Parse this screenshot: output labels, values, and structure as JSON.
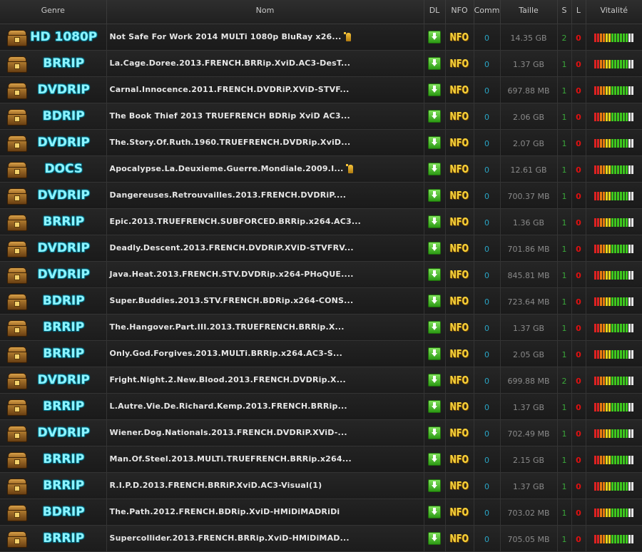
{
  "headers": {
    "genre": "Genre",
    "name": "Nom",
    "dl": "DL",
    "nfo": "NFO",
    "comm": "Comm",
    "size": "Taille",
    "s": "S",
    "l": "L",
    "vit": "Vitalité"
  },
  "rows": [
    {
      "genre": "HD 1080P",
      "name": "Not Safe For Work 2014 MULTi 1080p BluRay x26...",
      "fav": true,
      "nfo": "NFO",
      "comm": "0",
      "size": "14.35 GB",
      "s": "2",
      "l": "0"
    },
    {
      "genre": "BRRIP",
      "name": "La.Cage.Doree.2013.FRENCH.BRRip.XviD.AC3-DesT...",
      "fav": false,
      "nfo": "NFO",
      "comm": "0",
      "size": "1.37 GB",
      "s": "1",
      "l": "0"
    },
    {
      "genre": "DVDRIP",
      "name": "Carnal.Innocence.2011.FRENCH.DVDRiP.XViD-STVF...",
      "fav": false,
      "nfo": "NFO",
      "comm": "0",
      "size": "697.88 MB",
      "s": "1",
      "l": "0"
    },
    {
      "genre": "BDRIP",
      "name": "The Book Thief 2013 TRUEFRENCH BDRip XviD AC3...",
      "fav": false,
      "nfo": "NFO",
      "comm": "0",
      "size": "2.06 GB",
      "s": "1",
      "l": "0"
    },
    {
      "genre": "DVDRIP",
      "name": "The.Story.Of.Ruth.1960.TRUEFRENCH.DVDRip.XviD...",
      "fav": false,
      "nfo": "NFO",
      "comm": "0",
      "size": "2.07 GB",
      "s": "1",
      "l": "0"
    },
    {
      "genre": "DOCS",
      "name": "Apocalypse.La.Deuxieme.Guerre.Mondiale.2009.I...",
      "fav": true,
      "nfo": "NFO",
      "comm": "0",
      "size": "12.61 GB",
      "s": "1",
      "l": "0"
    },
    {
      "genre": "DVDRIP",
      "name": "Dangereuses.Retrouvailles.2013.FRENCH.DVDRiP....",
      "fav": false,
      "nfo": "NFO",
      "comm": "0",
      "size": "700.37 MB",
      "s": "1",
      "l": "0"
    },
    {
      "genre": "BRRIP",
      "name": "Epic.2013.TRUEFRENCH.SUBFORCED.BRRip.x264.AC3...",
      "fav": false,
      "nfo": "NFO",
      "comm": "0",
      "size": "1.36 GB",
      "s": "1",
      "l": "0"
    },
    {
      "genre": "DVDRIP",
      "name": "Deadly.Descent.2013.FRENCH.DVDRiP.XViD-STVFRV...",
      "fav": false,
      "nfo": "NFO",
      "comm": "0",
      "size": "701.86 MB",
      "s": "1",
      "l": "0"
    },
    {
      "genre": "DVDRIP",
      "name": "Java.Heat.2013.FRENCH.STV.DVDRip.x264-PHoQUE....",
      "fav": false,
      "nfo": "NFO",
      "comm": "0",
      "size": "845.81 MB",
      "s": "1",
      "l": "0"
    },
    {
      "genre": "BDRIP",
      "name": "Super.Buddies.2013.STV.FRENCH.BDRip.x264-CONS...",
      "fav": false,
      "nfo": "NFO",
      "comm": "0",
      "size": "723.64 MB",
      "s": "1",
      "l": "0"
    },
    {
      "genre": "BRRIP",
      "name": "The.Hangover.Part.III.2013.TRUEFRENCH.BRRip.X...",
      "fav": false,
      "nfo": "NFO",
      "comm": "0",
      "size": "1.37 GB",
      "s": "1",
      "l": "0"
    },
    {
      "genre": "BRRIP",
      "name": "Only.God.Forgives.2013.MULTi.BRRip.x264.AC3-S...",
      "fav": false,
      "nfo": "NFO",
      "comm": "0",
      "size": "2.05 GB",
      "s": "1",
      "l": "0"
    },
    {
      "genre": "DVDRIP",
      "name": "Fright.Night.2.New.Blood.2013.FRENCH.DVDRip.X...",
      "fav": false,
      "nfo": "NFO",
      "comm": "0",
      "size": "699.88 MB",
      "s": "2",
      "l": "0"
    },
    {
      "genre": "BRRIP",
      "name": "L.Autre.Vie.De.Richard.Kemp.2013.FRENCH.BRRip...",
      "fav": false,
      "nfo": "NFO",
      "comm": "0",
      "size": "1.37 GB",
      "s": "1",
      "l": "0"
    },
    {
      "genre": "DVDRIP",
      "name": "Wiener.Dog.Nationals.2013.FRENCH.DVDRiP.XViD-...",
      "fav": false,
      "nfo": "NFO",
      "comm": "0",
      "size": "702.49 MB",
      "s": "1",
      "l": "0"
    },
    {
      "genre": "BRRIP",
      "name": "Man.Of.Steel.2013.MULTi.TRUEFRENCH.BRRip.x264...",
      "fav": false,
      "nfo": "NFO",
      "comm": "0",
      "size": "2.15 GB",
      "s": "1",
      "l": "0"
    },
    {
      "genre": "BRRIP",
      "name": "R.I.P.D.2013.FRENCH.BRRiP.XviD.AC3-Visual(1)",
      "fav": false,
      "nfo": "NFO",
      "comm": "0",
      "size": "1.37 GB",
      "s": "1",
      "l": "0"
    },
    {
      "genre": "BDRIP",
      "name": "The.Path.2012.FRENCH.BDRip.XviD-HMiDiMADRiDi",
      "fav": false,
      "nfo": "NFO",
      "comm": "0",
      "size": "703.02 MB",
      "s": "1",
      "l": "0"
    },
    {
      "genre": "BRRIP",
      "name": "Supercollider.2013.FRENCH.BRRip.XviD-HMiDiMAD...",
      "fav": false,
      "nfo": "NFO",
      "comm": "0",
      "size": "705.05 MB",
      "s": "1",
      "l": "0"
    }
  ],
  "colors": {
    "seed": "#3aa83a",
    "leech": "#e01010",
    "comm": "#29a4c4",
    "nfo": "#f5d23b",
    "genre": "#8ff4ff"
  },
  "icons": {
    "genre": "treasure-chest-icon",
    "dl": "download-arrow-icon",
    "fav": "bookmark-icon",
    "nfo": "nfo-icon"
  }
}
